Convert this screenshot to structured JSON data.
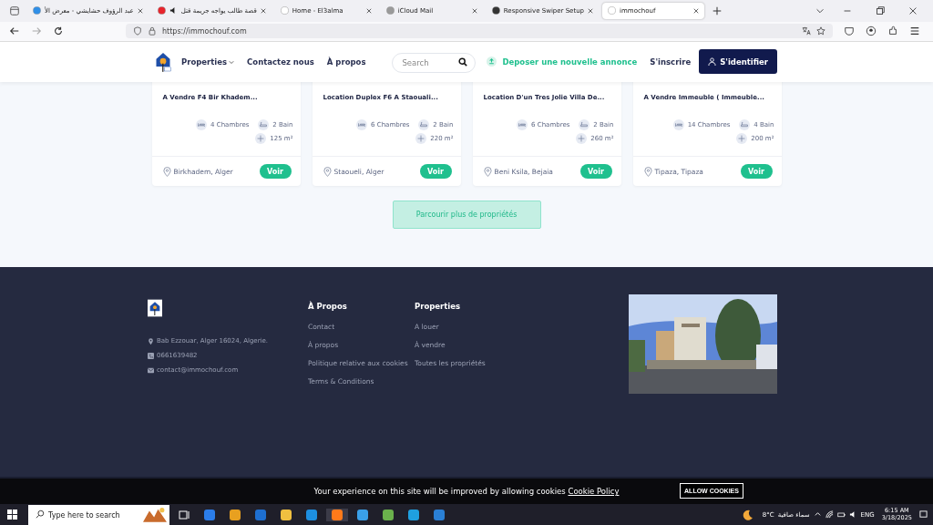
{
  "browser": {
    "tabs": [
      {
        "title": "عبد الرؤوف حشايشي - معرض الأ",
        "selected": false,
        "audio": false,
        "color": "#2f8fe8"
      },
      {
        "title": "قصة طالب يواجه جريمة قتل",
        "selected": false,
        "audio": true,
        "color": "#e8242c"
      },
      {
        "title": "Home - El3alma",
        "selected": false,
        "audio": false,
        "color": "#ffffff"
      },
      {
        "title": "iCloud Mail",
        "selected": false,
        "audio": false,
        "color": "#9a9a9a"
      },
      {
        "title": "Responsive Swiper Setup",
        "selected": false,
        "audio": false,
        "color": "#333333"
      },
      {
        "title": "immochouf",
        "selected": true,
        "audio": false,
        "color": "#ffffff"
      }
    ],
    "url": "https://immochouf.com"
  },
  "header": {
    "nav": [
      {
        "label": "Properties",
        "dropdown": true
      },
      {
        "label": "Contactez nous",
        "dropdown": false
      },
      {
        "label": "À propos",
        "dropdown": false
      }
    ],
    "search": {
      "placeholder": "Search"
    },
    "post_ad": "Deposer une nouvelle annonce",
    "register": "S'inscrire",
    "login": "S'identifier"
  },
  "cards": [
    {
      "title": "A Vendre F4 Bir Khadem...",
      "rooms": "4 Chambres",
      "baths": "2 Bain",
      "area": "125 m²",
      "location": "Birkhadem, Alger",
      "button": "Voir"
    },
    {
      "title": "Location Duplex F6 A Staouali...",
      "rooms": "6 Chambres",
      "baths": "2 Bain",
      "area": "220 m²",
      "location": "Staoueli, Alger",
      "button": "Voir"
    },
    {
      "title": "Location D'un Tres Jolie Villa De...",
      "rooms": "6 Chambres",
      "baths": "2 Bain",
      "area": "260 m²",
      "location": "Beni Ksila, Bejaia",
      "button": "Voir"
    },
    {
      "title": "A Vendre Immeuble ( Immeuble...",
      "rooms": "14 Chambres",
      "baths": "4 Bain",
      "area": "200 m²",
      "location": "Tipaza, Tipaza",
      "button": "Voir"
    }
  ],
  "browse_button": "Parcourir plus de propriétés",
  "footer": {
    "address": "Bab Ezzouar, Alger 16024, Algerie.",
    "phone": "0661639482",
    "email": "contact@immochouf.com",
    "columns": [
      {
        "heading": "À Propos",
        "links": [
          "Contact",
          "À propos",
          "Politique relative aux cookies",
          "Terms & Conditions"
        ]
      },
      {
        "heading": "Properties",
        "links": [
          "A louer",
          "À vendre",
          "Toutes les propriétés"
        ]
      }
    ]
  },
  "cookie_bar": {
    "text": "Your experience on this site will be improved by allowing cookies",
    "link": "Cookie Policy",
    "button": "ALLOW COOKIES"
  },
  "taskbar": {
    "search_placeholder": "Type here to search",
    "temperature": "8°C",
    "weather": "سماء صافية",
    "language": "ENG",
    "time": "6:15 AM",
    "date": "3/18/2025"
  }
}
